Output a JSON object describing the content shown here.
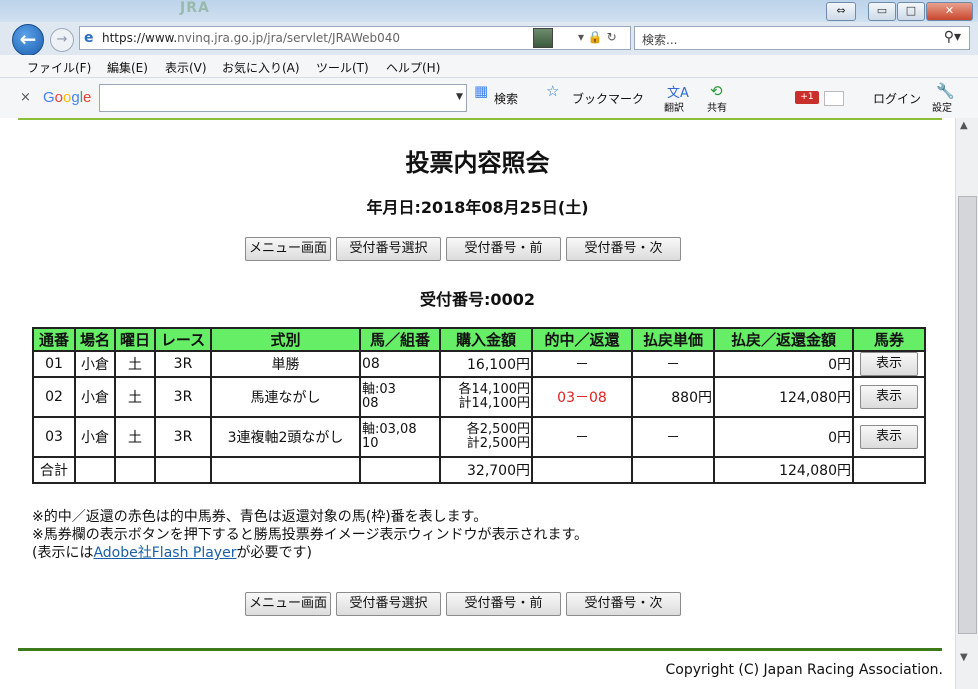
{
  "browser": {
    "blurred_title": "JRA",
    "window_buttons": {
      "restore": "⇔",
      "minimize": "▭",
      "maximize": "□",
      "close": "✕"
    },
    "url_prefix": "https://www.",
    "url_host": "nvinq.jra.go.jp",
    "url_path": "/jra/servlet/JRAWeb040",
    "search_placeholder": "検索...",
    "menu": [
      "ファイル(F)",
      "編集(E)",
      "表示(V)",
      "お気に入り(A)",
      "ツール(T)",
      "ヘルプ(H)"
    ],
    "google": {
      "close": "×",
      "logo": "Google",
      "search_btn": "検索",
      "bookmark": "ブックマーク",
      "translate": "翻訳",
      "share": "共有",
      "gplus": "+1",
      "login": "ログイン",
      "settings": "設定"
    },
    "colors": {
      "accent_green": "#66ee66",
      "hit_red": "#dd2222"
    }
  },
  "page": {
    "title": "投票内容照会",
    "date": "年月日:2018年08月25日(土)",
    "buttons": [
      "メニュー画面",
      "受付番号選択",
      "受付番号・前",
      "受付番号・次"
    ],
    "receipt": "受付番号:0002",
    "table": {
      "headers": [
        "通番",
        "場名",
        "曜日",
        "レース",
        "式別",
        "馬／組番",
        "購入金額",
        "的中／返還",
        "払戻単価",
        "払戻／返還金額",
        "馬券"
      ],
      "rows": [
        {
          "no": "01",
          "venue": "小倉",
          "day": "土",
          "race": "3R",
          "type": "単勝",
          "combo1": "08",
          "combo2": "",
          "amt1": "16,100円",
          "amt2": "",
          "hit": "－",
          "unit": "－",
          "payout": "0円",
          "btn": "表示"
        },
        {
          "no": "02",
          "venue": "小倉",
          "day": "土",
          "race": "3R",
          "type": "馬連ながし",
          "combo1": "軸:03",
          "combo2": "08",
          "amt1": "各14,100円",
          "amt2": "計14,100円",
          "hit": "03－08",
          "unit": "880円",
          "payout": "124,080円",
          "btn": "表示"
        },
        {
          "no": "03",
          "venue": "小倉",
          "day": "土",
          "race": "3R",
          "type": "3連複軸2頭ながし",
          "combo1": "軸:03,08",
          "combo2": "10",
          "amt1": "各2,500円",
          "amt2": "計2,500円",
          "hit": "－",
          "unit": "－",
          "payout": "0円",
          "btn": "表示"
        }
      ],
      "total": {
        "label": "合計",
        "amount": "32,700円",
        "payout": "124,080円"
      }
    },
    "notes": {
      "line1": "※的中／返還の赤色は的中馬券、青色は返還対象の馬(枠)番を表します。",
      "line2": "※馬券欄の表示ボタンを押下すると勝馬投票券イメージ表示ウィンドウが表示されます。",
      "line3_pre": "(表示には",
      "line3_link": "Adobe社Flash Player",
      "line3_post": "が必要です)"
    },
    "copyright": "Copyright (C) Japan Racing Association."
  }
}
